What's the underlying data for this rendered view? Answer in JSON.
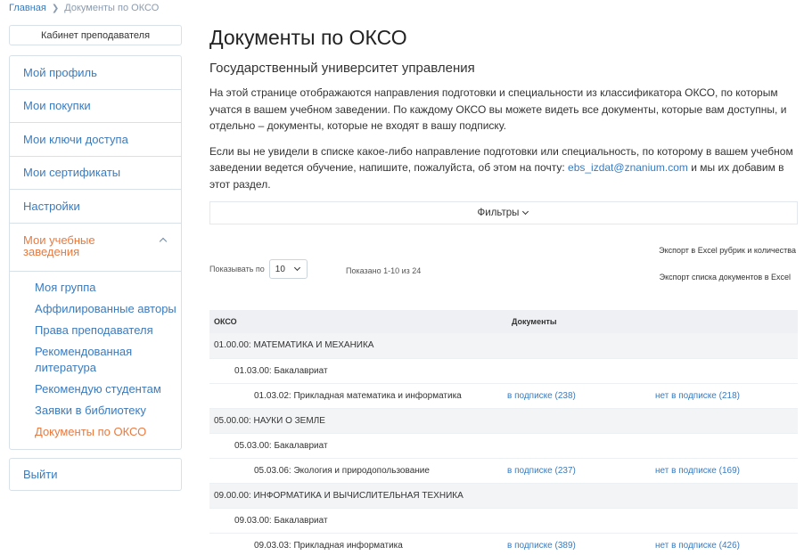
{
  "breadcrumb": {
    "home": "Главная",
    "current": "Документы по ОКСО"
  },
  "sidebar": {
    "cabinet_button": "Кабинет преподавателя",
    "items": [
      {
        "label": "Мой профиль"
      },
      {
        "label": "Мои покупки"
      },
      {
        "label": "Мои ключи доступа"
      },
      {
        "label": "Мои сертификаты"
      },
      {
        "label": "Настройки"
      }
    ],
    "active": {
      "label": "Мои учебные заведения"
    },
    "subitems": [
      {
        "label": "Моя группа"
      },
      {
        "label": "Аффилированные авторы"
      },
      {
        "label": "Права преподавателя"
      },
      {
        "label": "Рекомендованная литература"
      },
      {
        "label": "Рекомендую студентам"
      },
      {
        "label": "Заявки в библиотеку"
      },
      {
        "label": "Документы по ОКСО"
      }
    ],
    "logout": "Выйти"
  },
  "main": {
    "title": "Документы по ОКСО",
    "university": "Государственный университет управления",
    "para1": "На этой странице отображаются направления подготовки и специальности из классификатора ОКСО, по которым учатся в вашем учебном заведении. По каждому ОКСО вы можете видеть все документы, которые вам доступны, и отдельно – документы, которые не входят в вашу подписку.",
    "para2_before": "Если вы не увидели в списке какое-либо направление подготовки или специальность, по которому в вашем учебном заведении ведется обучение, напишите, пожалуйста, об этом на почту: ",
    "email": "ebs_izdat@znanium.com",
    "para2_after": " и мы их добавим в этот раздел.",
    "filters": "Фильтры",
    "export_rubrics": "Экспорт в Excel рубрик и количества",
    "export_docs": "Экспорт списка документов в Excel",
    "show_by_label": "Показывать по",
    "page_size": "10",
    "shown_text": "Показано 1-10 из 24"
  },
  "table": {
    "headers": {
      "okso": "ОКСО",
      "docs": "Документы"
    },
    "rows": [
      {
        "level": 1,
        "name": "01.00.00: МАТЕМАТИКА И МЕХАНИКА"
      },
      {
        "level": 2,
        "name": "01.03.00: Бакалавриат"
      },
      {
        "level": 3,
        "name": "01.03.02: Прикладная математика и информатика",
        "in_sub": "в подписке (238)",
        "not_sub": "нет в подписке (218)"
      },
      {
        "level": 1,
        "name": "05.00.00: НАУКИ О ЗЕМЛЕ"
      },
      {
        "level": 2,
        "name": "05.03.00: Бакалавриат"
      },
      {
        "level": 3,
        "name": "05.03.06: Экология и природопользование",
        "in_sub": "в подписке (237)",
        "not_sub": "нет в подписке (169)"
      },
      {
        "level": 1,
        "name": "09.00.00: ИНФОРМАТИКА И ВЫЧИСЛИТЕЛЬНАЯ ТЕХНИКА"
      },
      {
        "level": 2,
        "name": "09.03.00: Бакалавриат"
      },
      {
        "level": 3,
        "name": "09.03.03: Прикладная информатика",
        "in_sub": "в подписке (389)",
        "not_sub": "нет в подписке (426)"
      }
    ]
  },
  "colors": {
    "link": "#3a7bbf",
    "active": "#e87a40",
    "border": "#d8e0e8",
    "header_bg": "#eef0f3"
  },
  "icons": {
    "breadcrumb_separator": "chevron-right-icon",
    "submenu_toggle": "chevron-up-icon",
    "filters_toggle": "chevron-down-icon",
    "select_toggle": "chevron-down-icon"
  }
}
